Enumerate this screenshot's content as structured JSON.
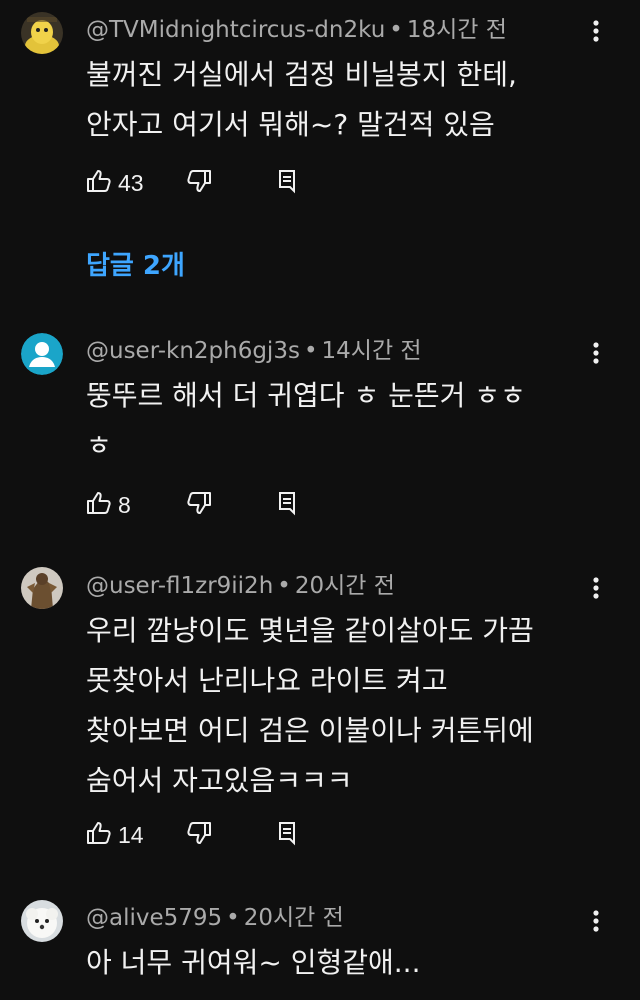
{
  "separator": "•",
  "top_comment": {
    "username": "@TVMidnightcircus-dn2ku",
    "time": "18시간 전",
    "lines": [
      "불꺼진 거실에서 검정 비닐봉지 한테,",
      "안자고 여기서 뭐해~? 말건적 있음"
    ],
    "likes": "43"
  },
  "replies_link": "답글 2개",
  "comments": [
    {
      "username": "@user-kn2ph6gj3s",
      "time": "14시간 전",
      "lines": [
        "뚱뚜르 해서 더 귀엽다 ㅎ 눈뜬거 ㅎㅎ",
        "ㅎ"
      ],
      "likes": "8"
    },
    {
      "username": "@user-fl1zr9ii2h",
      "time": "20시간 전",
      "lines": [
        "우리 깜냥이도 몇년을 같이살아도 가끔",
        "못찾아서 난리나요 라이트 켜고",
        "찾아보면 어디 검은 이불이나 커튼뒤에",
        "숨어서 자고있음ㅋㅋㅋ"
      ],
      "likes": "14"
    },
    {
      "username": "@alive5795",
      "time": "20시간 전",
      "lines": [
        "아 너무 귀여워~ 인형같애..."
      ]
    }
  ],
  "colors": {
    "background": "#0f0f0f",
    "text": "#f1f1f1",
    "meta": "#aaaaaa",
    "link": "#3ea6ff",
    "default_avatar": "#1aa5c9"
  }
}
